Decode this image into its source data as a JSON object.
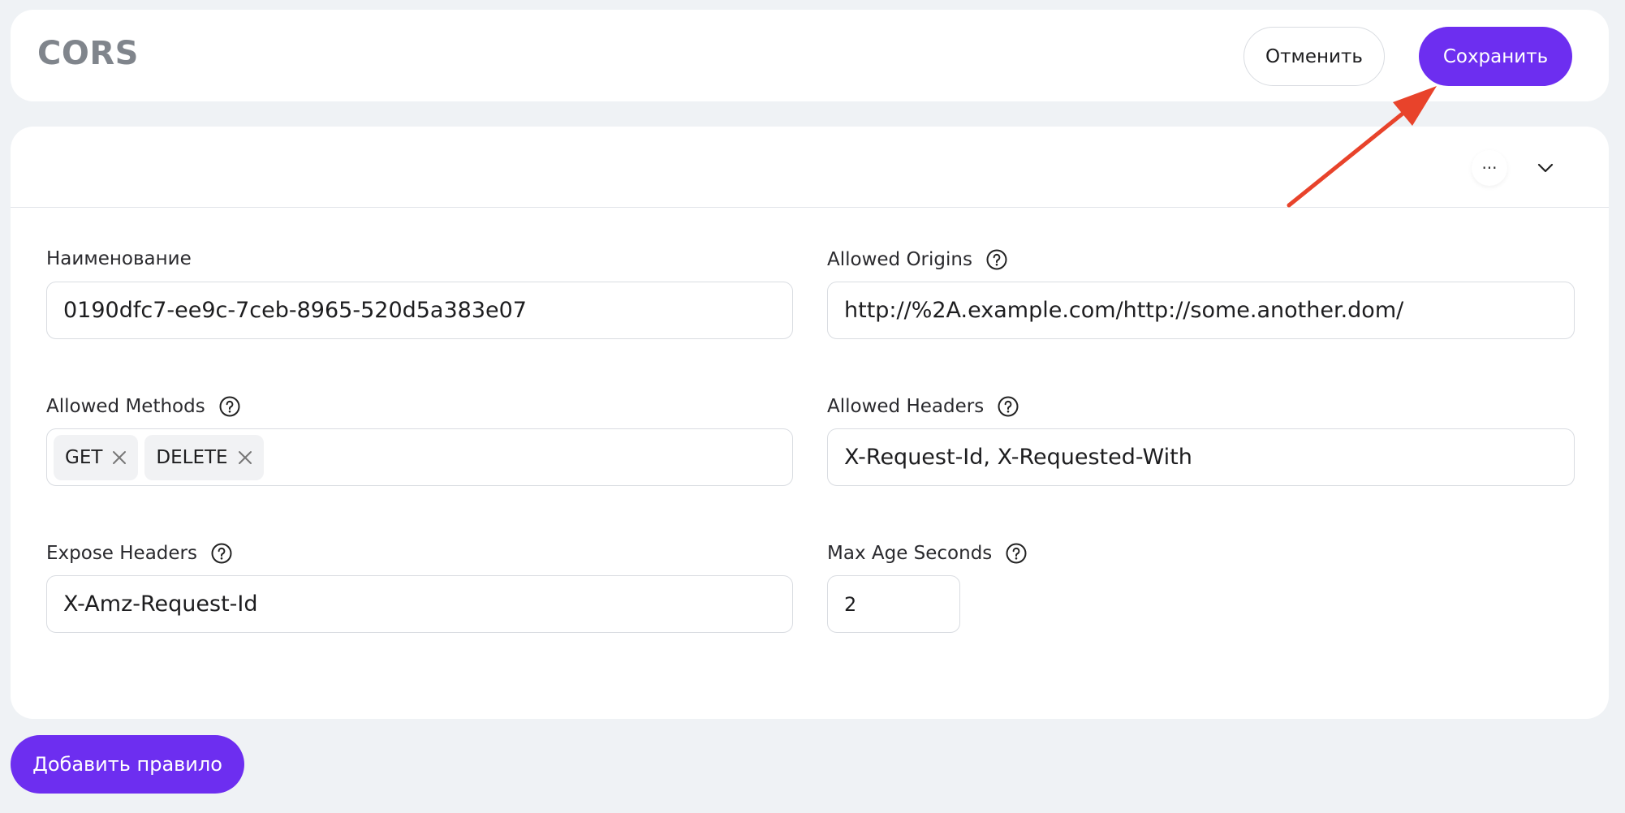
{
  "header": {
    "title": "CORS",
    "cancel_label": "Отменить",
    "save_label": "Сохранить"
  },
  "rule": {
    "more_label": "···",
    "fields": {
      "name": {
        "label": "Наименование",
        "value": "0190dfc7-ee9c-7ceb-8965-520d5a383e07"
      },
      "allowed_origins": {
        "label": "Allowed Origins",
        "value": "http://%2A.example.com/http://some.another.dom/"
      },
      "allowed_methods": {
        "label": "Allowed Methods",
        "tags": [
          "GET",
          "DELETE"
        ]
      },
      "allowed_headers": {
        "label": "Allowed Headers",
        "value": "X-Request-Id, X-Requested-With"
      },
      "expose_headers": {
        "label": "Expose Headers",
        "value": "X-Amz-Request-Id"
      },
      "max_age_seconds": {
        "label": "Max Age Seconds",
        "value": "2"
      }
    }
  },
  "add_rule_label": "Добавить правило",
  "colors": {
    "accent": "#6d2ef0",
    "background": "#eff2f5",
    "annotation_arrow": "#e8432b"
  }
}
